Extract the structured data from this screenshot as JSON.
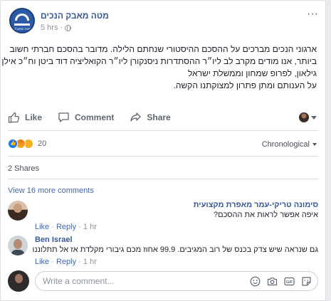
{
  "post": {
    "page_name": "מטה מאבק הנכים",
    "time": "5 hrs",
    "separator": "·",
    "avatar_text": "מטה מאבק הנכים",
    "lines": [
      "ארגוני הנכים מברכים על ההסכם ההיסטורי שנחתם הלילה. מדובר בהסכם חברתי חשוב",
      "ביותר, אנו מודים מקרב לב ליו״ר ההסתדרות ניסנקורן ליו״ר הקואליציה דוד ביטן וח״כ אילן",
      "גילאון, לפרופ שמחון וממשלת ישראל",
      "על הענותם ומתן פתרון למצוקתנו הקשה."
    ]
  },
  "actions": {
    "like": "Like",
    "comment": "Comment",
    "share": "Share"
  },
  "reactions": {
    "count": "20",
    "sort": "Chronological"
  },
  "shares": "2 Shares",
  "view_more": "View 16 more comments",
  "comments": [
    {
      "name": "סימונה טריקי-עמר מאפרת מקצועית",
      "text": "איפה אפשר לראות את ההסכם?",
      "like": "Like",
      "reply": "Reply",
      "time": "1 hr"
    },
    {
      "name": "Ben Israel",
      "text": "גם שנראה שיש צדק בכנס של רוב המגיבים. 99.9 אחוז מכם גיבורי מקלדת אז אל תתלוננו",
      "like": "Like",
      "reply": "Reply",
      "time": "1 hr"
    }
  ],
  "write_comment": {
    "placeholder": "Write a comment..."
  },
  "icons": {
    "more": "more-icon",
    "emoji": "emoji-icon",
    "camera": "camera-icon",
    "gif": "gif-icon",
    "sticker": "sticker-icon"
  },
  "colors": {
    "link": "#365899",
    "accent": "#4267b2",
    "muted": "#90949c"
  }
}
